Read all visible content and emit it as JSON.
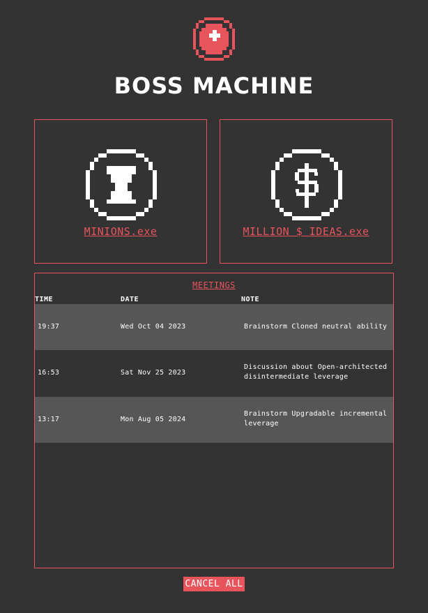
{
  "header": {
    "title": "BOSS MACHINE",
    "logo_icon": "red-button-logo-icon"
  },
  "cards": [
    {
      "label": "MINIONS.exe",
      "icon": "minion-icon"
    },
    {
      "label": "MILLION $ IDEAS.exe",
      "icon": "dollar-coin-icon"
    }
  ],
  "meetings": {
    "title": "MEETINGS",
    "columns": [
      "TIME",
      "DATE",
      "NOTE"
    ],
    "rows": [
      {
        "time": "19:37",
        "date": "Wed Oct 04 2023",
        "note": "Brainstorm Cloned neutral ability"
      },
      {
        "time": "16:53",
        "date": "Sat Nov 25 2023",
        "note": "Discussion about Open-architected disintermediate leverage"
      },
      {
        "time": "13:17",
        "date": "Mon Aug 05 2024",
        "note": "Brainstorm Upgradable incremental leverage"
      }
    ]
  },
  "cancel_button": {
    "label": "CANCEL ALL"
  },
  "colors": {
    "accent": "#e8545c",
    "background": "#333333",
    "row_shade": "#565656",
    "text": "#ffffff"
  }
}
